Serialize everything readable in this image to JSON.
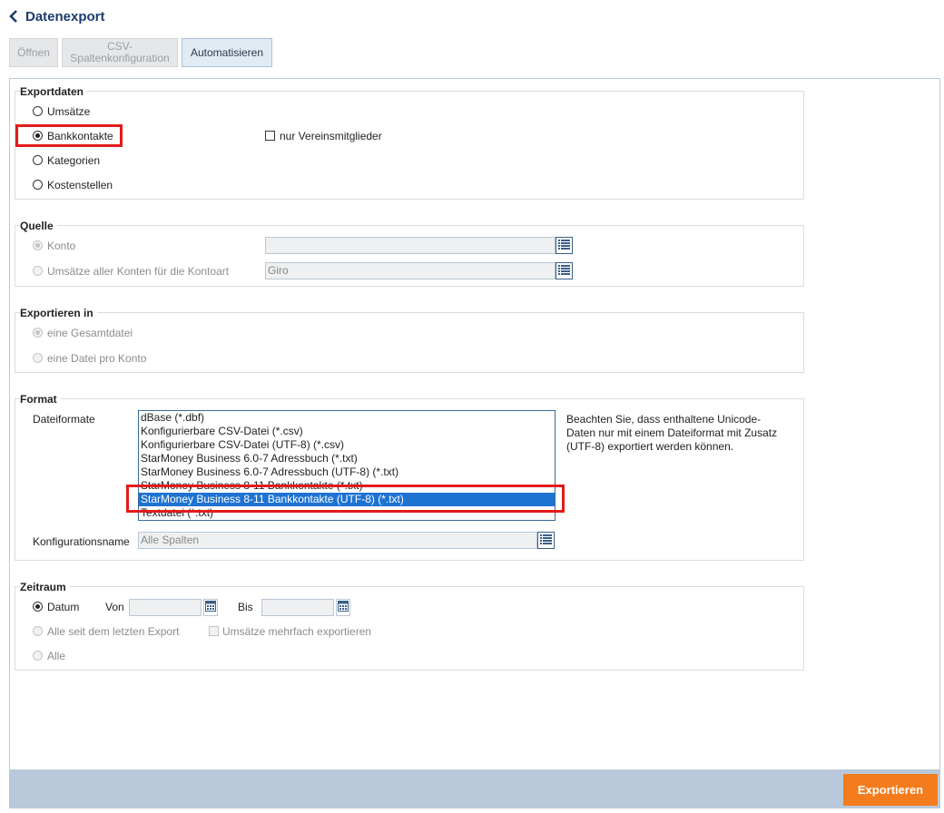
{
  "header": {
    "title": "Datenexport"
  },
  "tabs": [
    {
      "label": "Öffnen"
    },
    {
      "label": "CSV-\nSpaltenkonfiguration"
    },
    {
      "label": "Automatisieren"
    }
  ],
  "exportdaten": {
    "legend": "Exportdaten",
    "options": [
      "Umsätze",
      "Bankkontakte",
      "Kategorien",
      "Kostenstellen"
    ],
    "selected": "Bankkontakte",
    "checkbox_label": "nur Vereinsmitglieder"
  },
  "quelle": {
    "legend": "Quelle",
    "konto_label": "Konto",
    "konto_value": "",
    "kontoart_label": "Umsätze aller Konten für die Kontoart",
    "kontoart_value": "Giro"
  },
  "exportieren_in": {
    "legend": "Exportieren in",
    "options": [
      "eine Gesamtdatei",
      "eine Datei pro Konto"
    ]
  },
  "format": {
    "legend": "Format",
    "dateiformate_label": "Dateiformate",
    "items": [
      "dBase (*.dbf)",
      "Konfigurierbare CSV-Datei (*.csv)",
      "Konfigurierbare CSV-Datei (UTF-8) (*.csv)",
      "StarMoney Business 6.0-7 Adressbuch (*.txt)",
      "StarMoney Business 6.0-7 Adressbuch (UTF-8) (*.txt)",
      "StarMoney Business 8-11 Bankkontakte (*.txt)",
      "StarMoney Business 8-11 Bankkontakte (UTF-8) (*.txt)",
      "Textdatei (*.txt)"
    ],
    "selected_index": 6,
    "note": "Beachten Sie, dass enthaltene Unicode-Daten nur mit einem Dateiformat mit Zusatz (UTF-8) exportiert werden können.",
    "konfigurationsname_label": "Konfigurationsname",
    "konfigurationsname_value": "Alle Spalten"
  },
  "zeitraum": {
    "legend": "Zeitraum",
    "datum_label": "Datum",
    "von_label": "Von",
    "bis_label": "Bis",
    "von_value": "",
    "bis_value": "",
    "seit_label": "Alle seit dem letzten Export",
    "mehrfach_label": "Umsätze mehrfach exportieren",
    "alle_label": "Alle"
  },
  "footer": {
    "export_label": "Exportieren"
  },
  "colors": {
    "title": "#1b3c6e",
    "accent_button": "#f47c1c",
    "list_selection": "#1e73d2",
    "highlight": "#e21b1b",
    "footer_bar": "#b9c8da"
  },
  "icons": [
    "chevron-left-icon",
    "list-icon",
    "calendar-icon"
  ]
}
